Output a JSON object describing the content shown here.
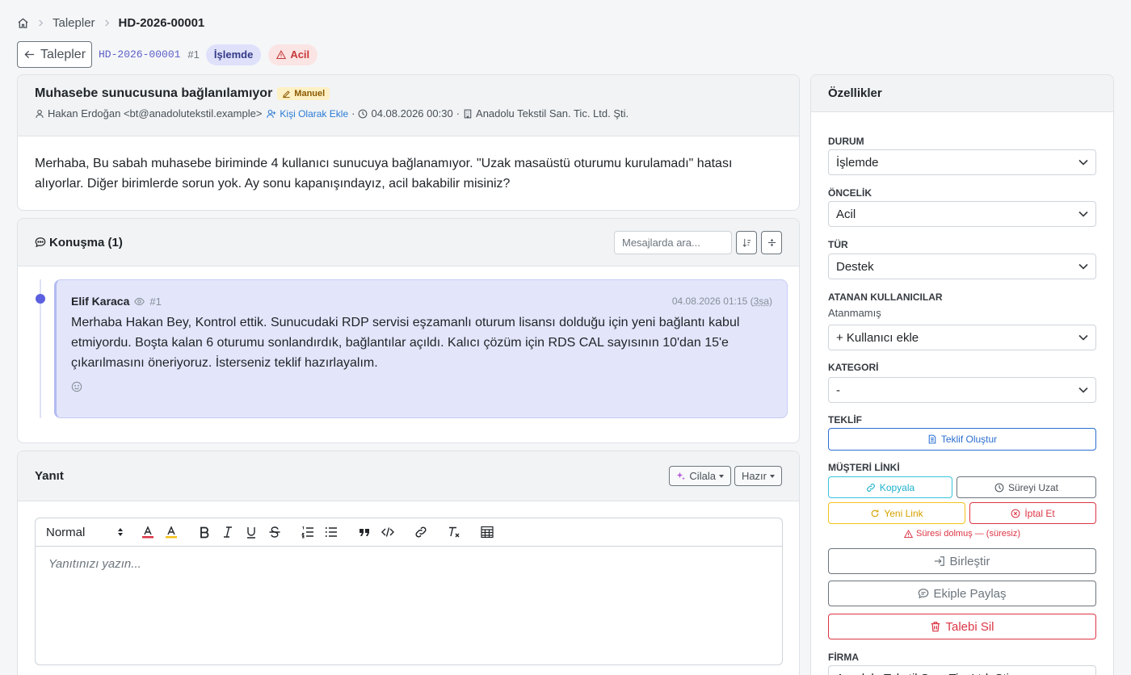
{
  "breadcrumb": {
    "items": [
      "Talepler",
      "HD-2026-00001"
    ]
  },
  "header": {
    "back_label": "Talepler",
    "ticket_code": "HD-2026-00001",
    "ticket_num": "#1",
    "status_badge": "İşlemde",
    "priority_badge": "Acil"
  },
  "ticket": {
    "title": "Muhasebe sunucusuna bağlanılamıyor",
    "source_badge": "Manuel",
    "requester": "Hakan Erdoğan <bt@anadolutekstil.example>",
    "add_contact": "Kişi Olarak Ekle",
    "created_at": "04.08.2026 00:30",
    "company": "Anadolu Tekstil San. Tic. Ltd. Şti.",
    "body": "Merhaba, Bu sabah muhasebe biriminde 4 kullanıcı sunucuya bağlanamıyor. \"Uzak masaüstü oturumu kurulamadı\" hatası alıyorlar. Diğer birimlerde sorun yok. Ay sonu kapanışındayız, acil bakabilir misiniz?"
  },
  "conversation": {
    "title": "Konuşma (1)",
    "search_placeholder": "Mesajlarda ara...",
    "messages": [
      {
        "author": "Elif Karaca",
        "num": "#1",
        "time": "04.08.2026 01:15",
        "relative": "3sa",
        "text": "Merhaba Hakan Bey, Kontrol ettik. Sunucudaki RDP servisi eşzamanlı oturum lisansı dolduğu için yeni bağlantı kabul etmiyordu. Boşta kalan 6 oturumu sonlandırdık, bağlantılar açıldı. Kalıcı çözüm için RDS CAL sayısının 10'dan 15'e çıkarılmasını öneriyoruz. İsterseniz teklif hazırlayalım."
      }
    ]
  },
  "reply": {
    "title": "Yanıt",
    "polish_label": "Cilala",
    "ready_label": "Hazır",
    "format_select": "Normal",
    "placeholder": "Yanıtınızı yazın..."
  },
  "properties": {
    "title": "Özellikler",
    "status_label": "DURUM",
    "status_value": "İşlemde",
    "priority_label": "ÖNCELİK",
    "priority_value": "Acil",
    "type_label": "TÜR",
    "type_value": "Destek",
    "assignees_label": "ATANAN KULLANICILAR",
    "assignees_value": "Atanmamış",
    "add_user": "+ Kullanıcı ekle",
    "category_label": "KATEGORİ",
    "category_value": "-",
    "quote_label": "TEKLİF",
    "quote_button": "Teklif Oluştur",
    "link_label": "MÜŞTERİ LİNKİ",
    "copy_button": "Kopyala",
    "extend_button": "Süreyi Uzat",
    "new_link_button": "Yeni Link",
    "cancel_button": "İptal Et",
    "expired_text": "Süresi dolmuş — (süresiz)",
    "merge_button": "Birleştir",
    "share_button": "Ekiple Paylaş",
    "delete_button": "Talebi Sil",
    "company_label": "FİRMA",
    "company_value": "Anadolu Tekstil San. Tic. Ltd. Şti."
  },
  "colors": {
    "accent": "#5b5fc7",
    "danger": "#dc3545",
    "message_bg": "#e3e6fb"
  }
}
